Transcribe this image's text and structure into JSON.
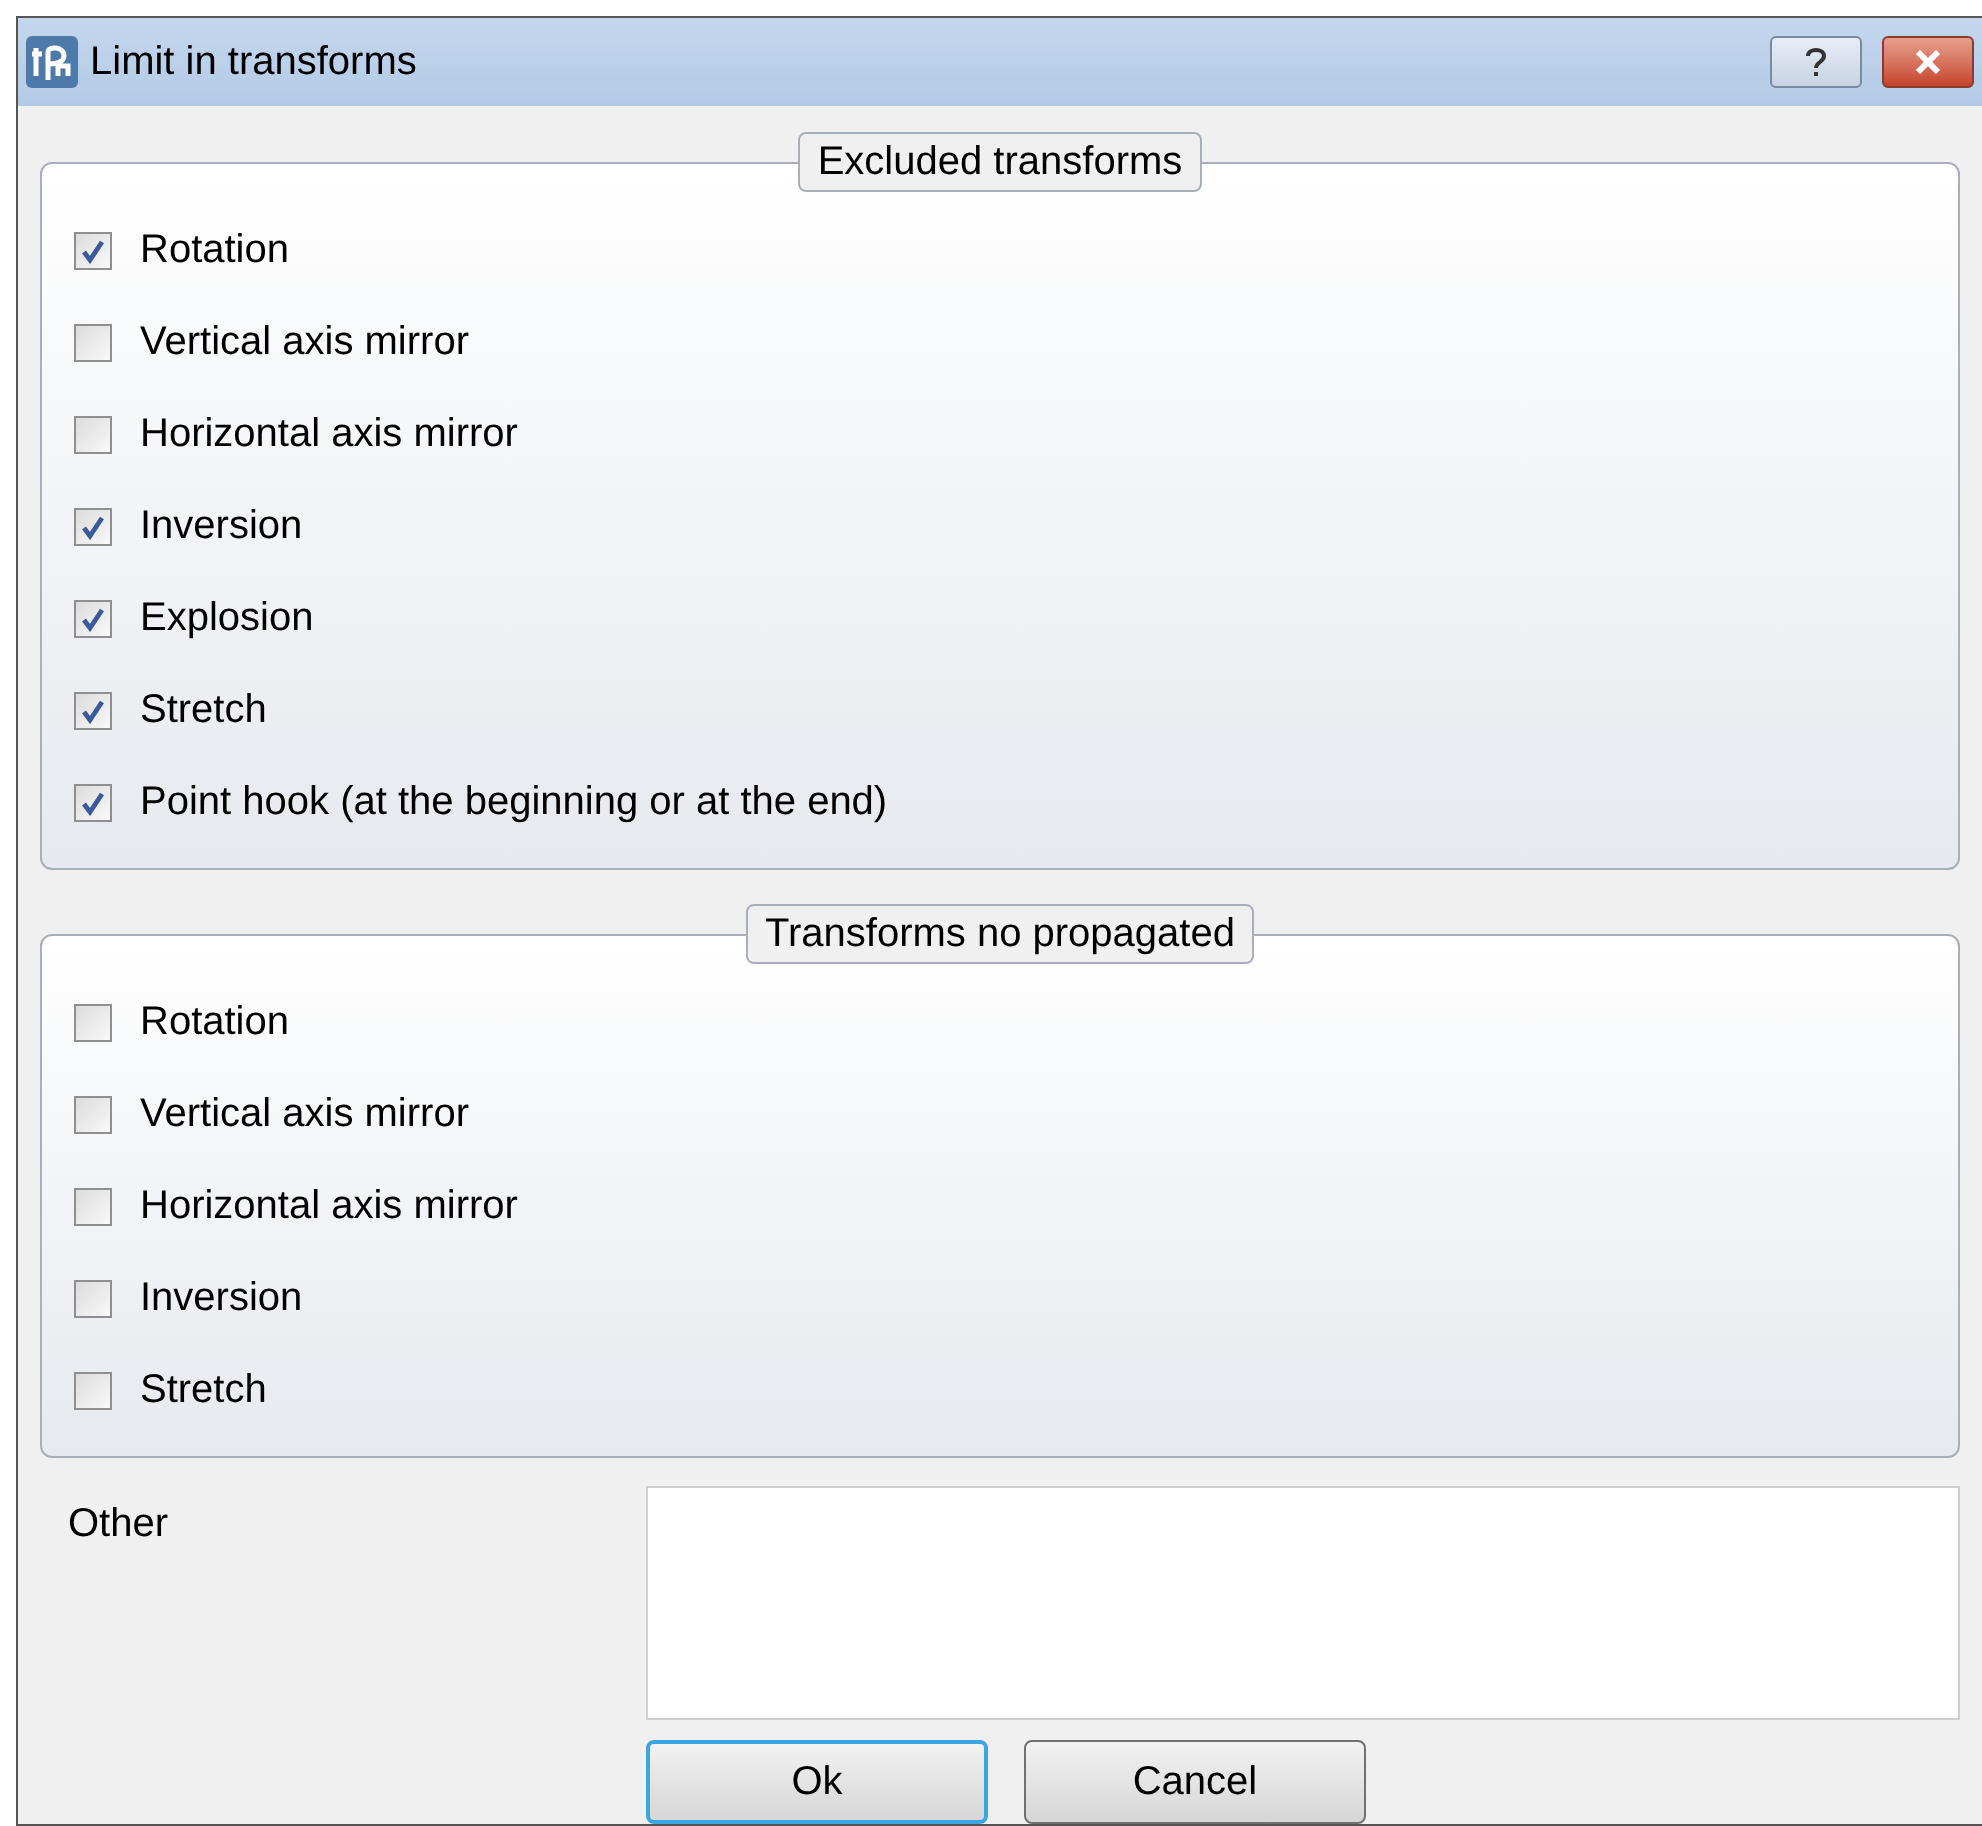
{
  "window": {
    "title": "Limit in transforms"
  },
  "groups": [
    {
      "title": "Excluded transforms",
      "items": [
        {
          "label": "Rotation",
          "checked": true
        },
        {
          "label": "Vertical axis mirror",
          "checked": false
        },
        {
          "label": "Horizontal axis mirror",
          "checked": false
        },
        {
          "label": "Inversion",
          "checked": true
        },
        {
          "label": "Explosion",
          "checked": true
        },
        {
          "label": "Stretch",
          "checked": true
        },
        {
          "label": "Point hook (at the beginning or at the end)",
          "checked": true
        }
      ]
    },
    {
      "title": "Transforms no propagated",
      "items": [
        {
          "label": "Rotation",
          "checked": false
        },
        {
          "label": "Vertical axis mirror",
          "checked": false
        },
        {
          "label": "Horizontal axis mirror",
          "checked": false
        },
        {
          "label": "Inversion",
          "checked": false
        },
        {
          "label": "Stretch",
          "checked": false
        }
      ]
    }
  ],
  "other": {
    "label": "Other"
  },
  "buttons": [
    {
      "label": "Ok",
      "default": true
    },
    {
      "label": "Cancel",
      "default": false
    }
  ]
}
